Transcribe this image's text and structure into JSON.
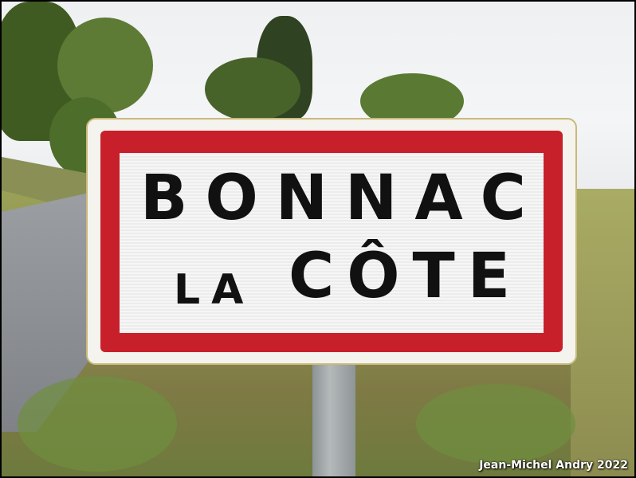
{
  "sign": {
    "line1": "BONNAC",
    "line2_small": "LA",
    "line2_large": "CÔTE",
    "colors": {
      "border": "#c8202a",
      "text": "#111111",
      "background": "#f4f3ee"
    }
  },
  "watermark": {
    "text": "Jean-Michel Andry 2022"
  }
}
